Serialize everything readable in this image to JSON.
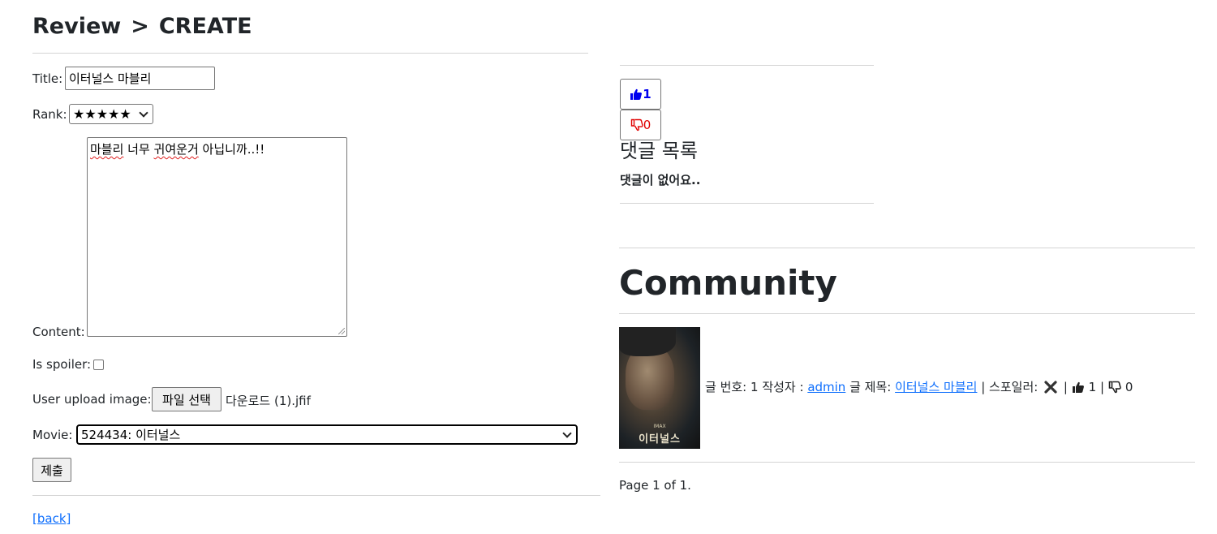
{
  "header": {
    "crumb_review": "Review",
    "separator": ">",
    "crumb_create": "CREATE"
  },
  "form": {
    "title_label": "Title:",
    "title_value": "이터널스 마블리",
    "rank_label": "Rank:",
    "rank_value": "★★★★★",
    "content_label": "Content:",
    "content_words": [
      "마블리",
      " 너무 ",
      "귀여운거",
      " 아닙니까..!!"
    ],
    "spoiler_label": "Is spoiler:",
    "image_label": "User upload image:",
    "file_button": "파일 선택",
    "file_name": "다운로드 (1).jfif",
    "movie_label": "Movie:",
    "movie_value": "524434: 이터널스",
    "submit_label": "제출",
    "back_link": "[back]"
  },
  "votes": {
    "like_count": "1",
    "dislike_count": "0",
    "like_color": "#0000ee",
    "dislike_color": "#e00000"
  },
  "comments": {
    "title": "댓글 목록",
    "empty_text": "댓글이 없어요.."
  },
  "community": {
    "title": "Community",
    "poster_title": "이터널스",
    "poster_sub": "IMAX",
    "post": {
      "number_label": "글 번호: ",
      "number": "1",
      "author_label": " 작성자 : ",
      "author": "admin",
      "subject_label": " 글 제목: ",
      "subject": "이터널스 마블리",
      "spoiler_label": " | 스포일러: ",
      "sep": " | ",
      "likes": "1",
      "dislikes": "0"
    },
    "page_info": "Page 1 of 1."
  },
  "colors": {
    "link": "#0d6efd",
    "text": "#212529",
    "divider": "#d4d4d4"
  }
}
